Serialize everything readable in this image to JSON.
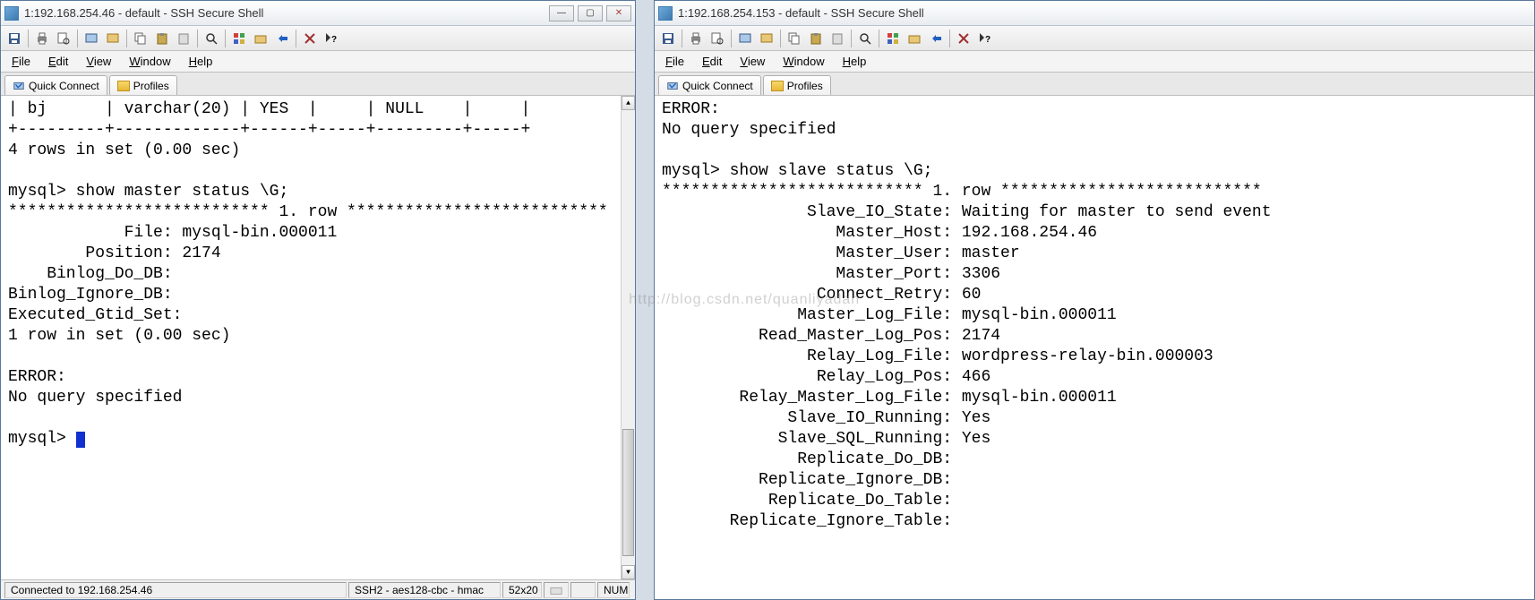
{
  "watermark": "http://blog.csdn.net/quanliyadan",
  "window1": {
    "title": "1:192.168.254.46 - default - SSH Secure Shell",
    "menus": {
      "file": "File",
      "edit": "Edit",
      "view": "View",
      "window": "Window",
      "help": "Help"
    },
    "tabs": {
      "quick_connect": "Quick Connect",
      "profiles": "Profiles"
    },
    "terminal_text": "| bj      | varchar(20) | YES  |     | NULL    |     |\n+---------+-------------+------+-----+---------+-----+\n4 rows in set (0.00 sec)\n\nmysql> show master status \\G;\n*************************** 1. row ***************************\n            File: mysql-bin.000011\n        Position: 2174\n    Binlog_Do_DB:\nBinlog_Ignore_DB:\nExecuted_Gtid_Set:\n1 row in set (0.00 sec)\n\nERROR:\nNo query specified\n\nmysql> ",
    "status": {
      "connected": "Connected to 192.168.254.46",
      "cipher": "SSH2 - aes128-cbc - hmac",
      "size": "52x20",
      "num": "NUM"
    }
  },
  "window2": {
    "title": "1:192.168.254.153 - default - SSH Secure Shell",
    "menus": {
      "file": "File",
      "edit": "Edit",
      "view": "View",
      "window": "Window",
      "help": "Help"
    },
    "tabs": {
      "quick_connect": "Quick Connect",
      "profiles": "Profiles"
    },
    "terminal_text": "ERROR:\nNo query specified\n\nmysql> show slave status \\G;\n*************************** 1. row ***************************\n               Slave_IO_State: Waiting for master to send event\n                  Master_Host: 192.168.254.46\n                  Master_User: master\n                  Master_Port: 3306\n                Connect_Retry: 60\n              Master_Log_File: mysql-bin.000011\n          Read_Master_Log_Pos: 2174\n               Relay_Log_File: wordpress-relay-bin.000003\n                Relay_Log_Pos: 466\n        Relay_Master_Log_File: mysql-bin.000011\n             Slave_IO_Running: Yes\n            Slave_SQL_Running: Yes\n              Replicate_Do_DB:\n          Replicate_Ignore_DB:\n           Replicate_Do_Table:\n       Replicate_Ignore_Table:"
  },
  "win_buttons": {
    "min": "—",
    "max": "▢",
    "close": "✕"
  }
}
